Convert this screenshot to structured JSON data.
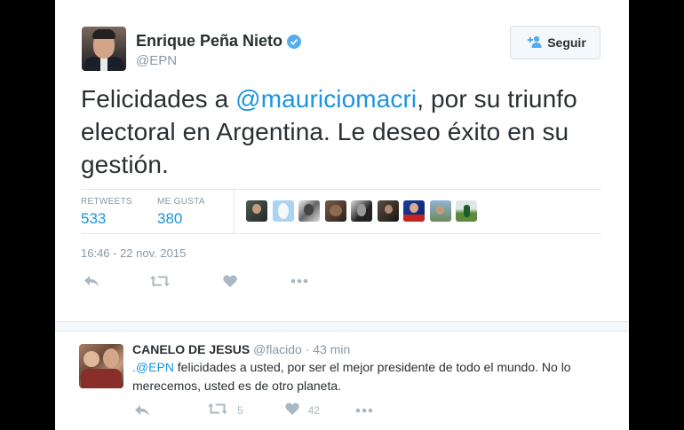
{
  "tweet": {
    "author_name": "Enrique Peña Nieto",
    "author_handle": "@EPN",
    "follow_label": "Seguir",
    "text_before": "Felicidades a ",
    "mention": "@mauriciomacri",
    "text_after": ", por su triunfo electoral en Argentina. Le deseo éxito en su gestión.",
    "retweets_label": "RETWEETS",
    "retweets_count": "533",
    "likes_label": "ME GUSTA",
    "likes_count": "380",
    "timestamp": "16:46 - 22 nov. 2015",
    "liker_avatars": [
      "avatar-1",
      "avatar-2",
      "avatar-3",
      "avatar-4",
      "avatar-5",
      "avatar-6",
      "avatar-7",
      "avatar-8",
      "avatar-9"
    ]
  },
  "reply": {
    "author_name": "CANELO DE JESUS",
    "author_handle": "@flacido",
    "separator": "·",
    "time": "43 min",
    "mention": ".@EPN",
    "text": " felicidades a usted, por ser el mejor presidente de todo el mundo. No lo merecemos, usted es de otro planeta.",
    "retweet_count": "5",
    "like_count": "42"
  },
  "colors": {
    "link": "#1b95e0",
    "muted": "#8899a6",
    "icon": "#aab8c2",
    "verified": "#55acee"
  },
  "icons": [
    "verified-badge-icon",
    "add-user-icon",
    "reply-icon",
    "retweet-icon",
    "heart-icon",
    "more-icon"
  ]
}
